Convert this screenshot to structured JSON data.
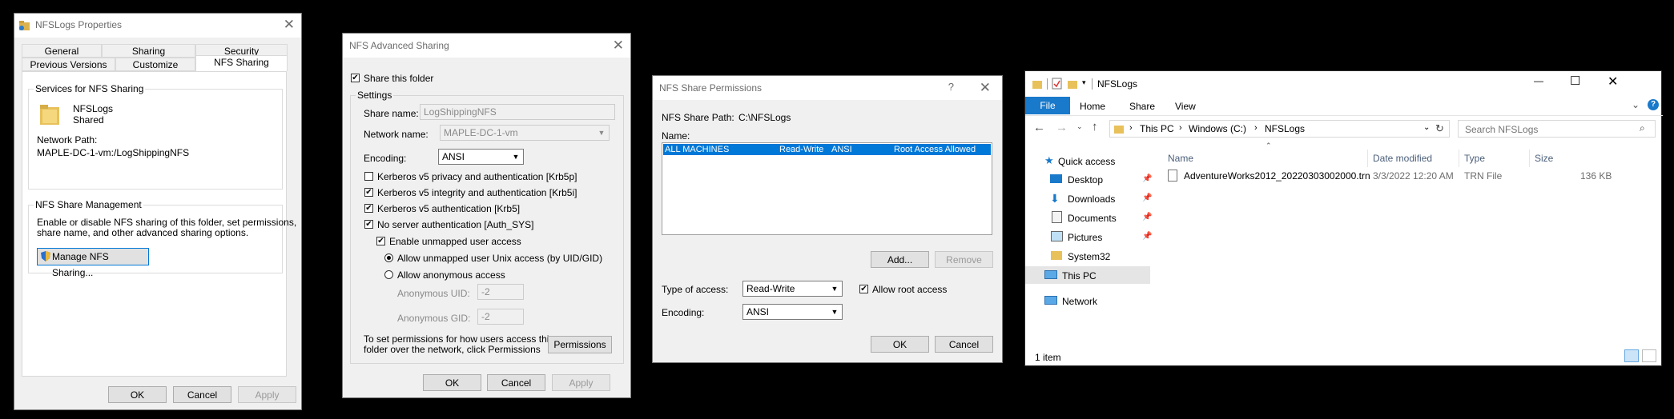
{
  "props": {
    "title": "NFSLogs Properties",
    "close": "✕",
    "tabs_row1": [
      "General",
      "Sharing",
      "Security"
    ],
    "tabs_row2": [
      "Previous Versions",
      "Customize",
      "NFS Sharing"
    ],
    "services_group": "Services for NFS Sharing",
    "folder_name": "NFSLogs",
    "folder_status": "Shared",
    "network_path_label": "Network Path:",
    "network_path": "MAPLE-DC-1-vm:/LogShippingNFS",
    "mgmt_group": "NFS Share Management",
    "mgmt_desc1": "Enable or disable NFS sharing of this folder, set permissions,",
    "mgmt_desc2": "share name, and other advanced sharing options.",
    "manage_btn": "Manage NFS Sharing...",
    "ok": "OK",
    "cancel": "Cancel",
    "apply": "Apply"
  },
  "adv": {
    "title": "NFS Advanced Sharing",
    "close": "✕",
    "share_folder": "Share this folder",
    "settings": "Settings",
    "share_name_label": "Share name:",
    "share_name": "LogShippingNFS",
    "network_name_label": "Network name:",
    "network_name": "MAPLE-DC-1-vm",
    "encoding_label": "Encoding:",
    "encoding": "ANSI",
    "krb5p": "Kerberos v5 privacy and authentication [Krb5p]",
    "krb5i": "Kerberos v5 integrity and authentication [Krb5i]",
    "krb5": "Kerberos v5 authentication [Krb5]",
    "auth_sys": "No server authentication [Auth_SYS]",
    "unmapped": "Enable unmapped user access",
    "unix_access": "Allow unmapped user Unix access (by UID/GID)",
    "anon_access": "Allow anonymous access",
    "anon_uid_label": "Anonymous UID:",
    "anon_uid": "-2",
    "anon_gid_label": "Anonymous GID:",
    "anon_gid": "-2",
    "perm_desc1": "To set permissions for how users access this",
    "perm_desc2": "folder over the network, click Permissions",
    "permissions_btn": "Permissions",
    "ok": "OK",
    "cancel": "Cancel",
    "apply": "Apply"
  },
  "perm": {
    "title": "NFS Share Permissions",
    "help": "?",
    "close": "✕",
    "path_label": "NFS Share Path:",
    "path": "C:\\NFSLogs",
    "name_label": "Name:",
    "row": {
      "name": "ALL MACHINES",
      "access": "Read-Write",
      "encoding": "ANSI",
      "root": "Root Access Allowed"
    },
    "add_btn": "Add...",
    "remove_btn": "Remove",
    "type_label": "Type of access:",
    "type_value": "Read-Write",
    "allow_root": "Allow root access",
    "encoding_label": "Encoding:",
    "encoding_value": "ANSI",
    "ok": "OK",
    "cancel": "Cancel"
  },
  "explorer": {
    "title": "NFSLogs",
    "minimize": "—",
    "maximize": "☐",
    "close": "✕",
    "ribbon": {
      "file": "File",
      "home": "Home",
      "share": "Share",
      "view": "View"
    },
    "breadcrumb": [
      "This PC",
      "Windows (C:)",
      "NFSLogs"
    ],
    "search_placeholder": "Search NFSLogs",
    "nav": [
      {
        "label": "Quick access"
      },
      {
        "label": "Desktop"
      },
      {
        "label": "Downloads"
      },
      {
        "label": "Documents"
      },
      {
        "label": "Pictures"
      },
      {
        "label": "System32"
      },
      {
        "label": "This PC"
      },
      {
        "label": "Network"
      }
    ],
    "columns": [
      "Name",
      "Date modified",
      "Type",
      "Size"
    ],
    "file": {
      "name": "AdventureWorks2012_20220303002000.trn",
      "date": "3/3/2022 12:20 AM",
      "type": "TRN File",
      "size": "136 KB"
    },
    "status": "1 item",
    "accent": "#0078d7"
  }
}
